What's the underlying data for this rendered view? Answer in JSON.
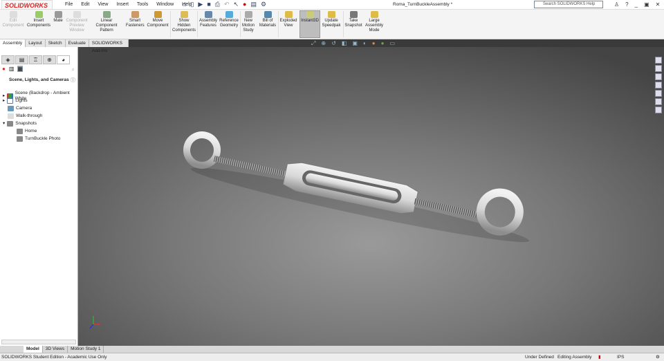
{
  "app": {
    "logo": "SOLIDWORKS",
    "document_title": "Roma_TurnBuckleAssembly *"
  },
  "menu": [
    "File",
    "Edit",
    "View",
    "Insert",
    "Tools",
    "Window",
    "Help"
  ],
  "search": {
    "placeholder": "Search SOLIDWORKS Help"
  },
  "ribbon": [
    {
      "label": "Edit Component",
      "disabled": true
    },
    {
      "label": "Insert Components"
    },
    {
      "label": "Mate"
    },
    {
      "label": "Component Preview Window",
      "disabled": true
    },
    {
      "label": "Linear Component Pattern"
    },
    {
      "label": "Smart Fasteners"
    },
    {
      "label": "Move Component"
    },
    {
      "label": "Show Hidden Components"
    },
    {
      "label": "Assembly Features"
    },
    {
      "label": "Reference Geometry"
    },
    {
      "label": "New Motion Study"
    },
    {
      "label": "Bill of Materials"
    },
    {
      "label": "Exploded View"
    },
    {
      "label": "Instant3D",
      "active": true
    },
    {
      "label": "Update Speedpak"
    },
    {
      "label": "Take Snapshot"
    },
    {
      "label": "Large Assembly Mode"
    }
  ],
  "tabs": [
    "Assembly",
    "Layout",
    "Sketch",
    "Evaluate",
    "SOLIDWORKS Add-Ins"
  ],
  "panel": {
    "title": "Scene, Lights, and Cameras",
    "tree": [
      {
        "label": "Scene (Backdrop - Ambient White",
        "level": 0,
        "expand": true
      },
      {
        "label": "Lights",
        "level": 0,
        "expand": true
      },
      {
        "label": "Camera",
        "level": 0
      },
      {
        "label": "Walk-through",
        "level": 0
      },
      {
        "label": "Snapshots",
        "level": 0,
        "expanded": true
      },
      {
        "label": "Home",
        "level": 1
      },
      {
        "label": "TurnBuckle Photo",
        "level": 1
      }
    ]
  },
  "bottom_tabs": [
    "Model",
    "3D Views",
    "Motion Study 1"
  ],
  "status": {
    "left": "SOLIDWORKS Student Edition - Academic Use Only",
    "state": "Under Defined",
    "mode": "Editing Assembly",
    "units": "IPS"
  },
  "colors": {
    "brand": "#d22",
    "ribbon_bg": "#f4f4f4",
    "viewport_dark": "#444444",
    "viewport_light": "#9a9a9a"
  }
}
